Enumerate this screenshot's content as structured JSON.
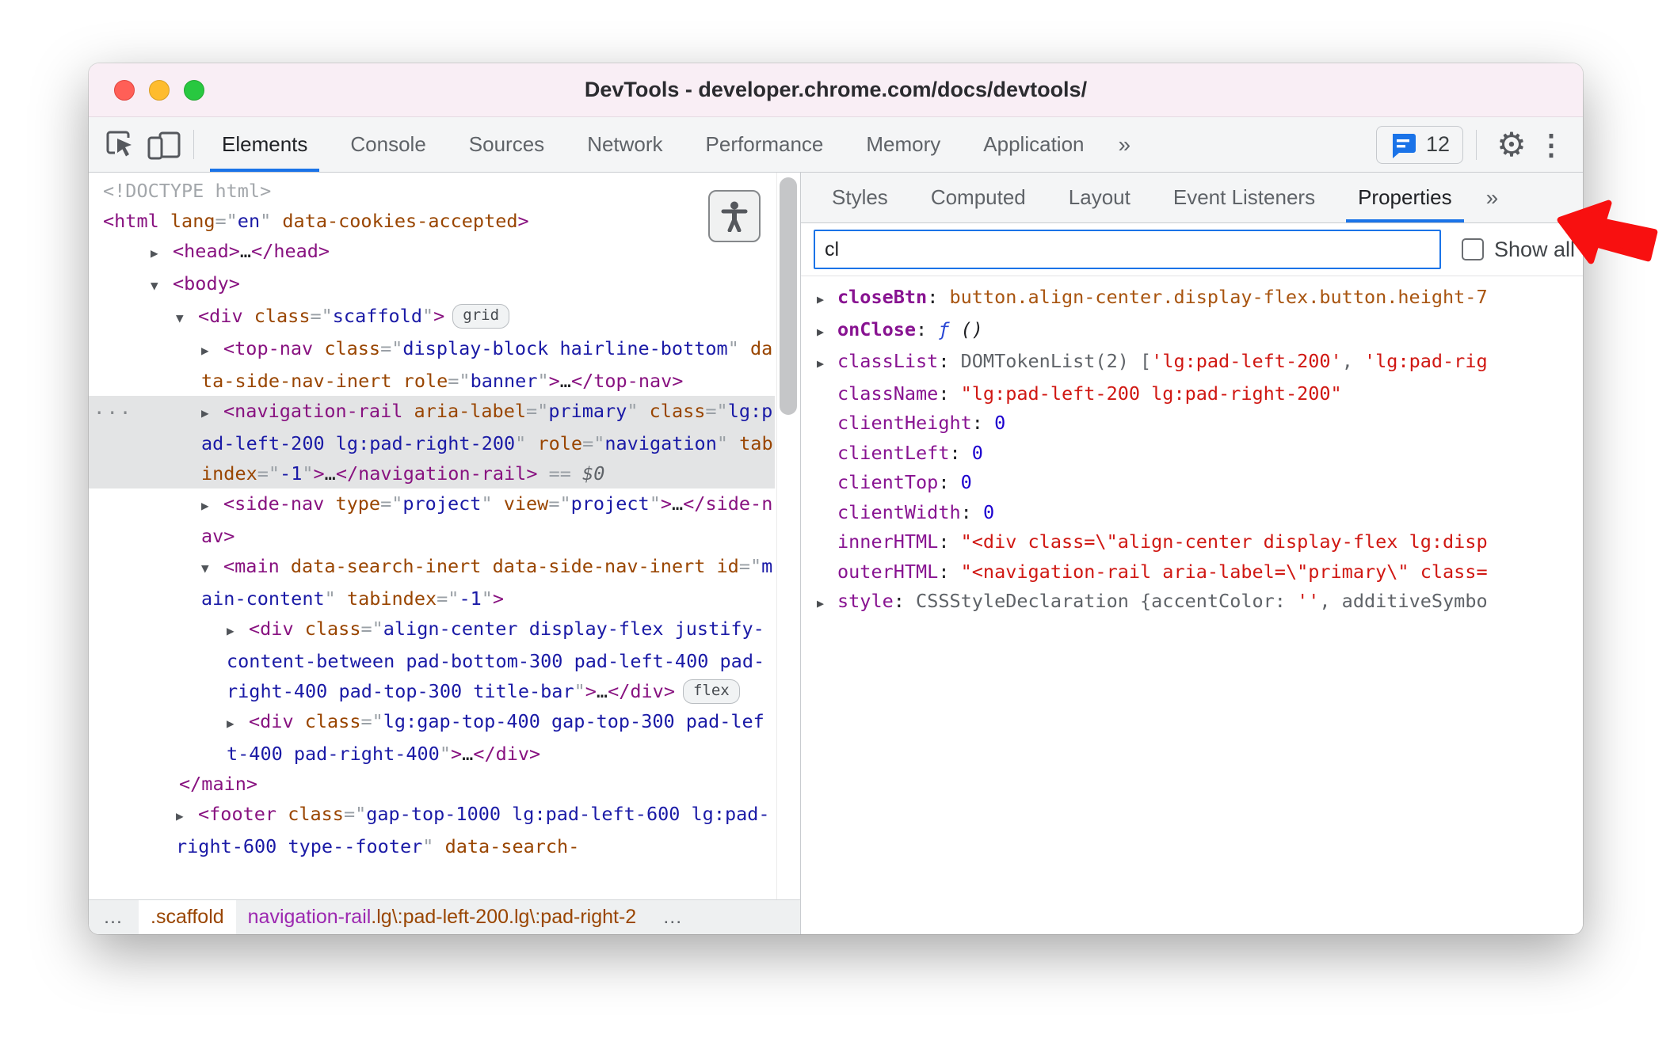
{
  "window": {
    "title": "DevTools - developer.chrome.com/docs/devtools/"
  },
  "colors": {
    "accent_blue": "#1a73e8",
    "titlebar_pink": "#f9eef5",
    "toolbar_gray": "#f4f5f6",
    "selection_gray": "#e3e4e5",
    "syntax_tag": "#881280",
    "syntax_attr_name": "#994500",
    "syntax_attr_value": "#1a1aa6",
    "prop_name_purple": "#881391",
    "string_red": "#d01712",
    "number_blue": "#1c00cf",
    "element_preview_brown": "#a8540f",
    "annotation_red": "#f81010",
    "crumb_tag_purple": "#9c27b0"
  },
  "toolbar": {
    "tabs": [
      {
        "label": "Elements",
        "active": true
      },
      {
        "label": "Console"
      },
      {
        "label": "Sources"
      },
      {
        "label": "Network"
      },
      {
        "label": "Performance"
      },
      {
        "label": "Memory"
      },
      {
        "label": "Application"
      }
    ],
    "more_tabs_chevron": "»",
    "issues": {
      "count": "12"
    }
  },
  "right_panel": {
    "tabs": [
      {
        "label": "Styles"
      },
      {
        "label": "Computed"
      },
      {
        "label": "Layout"
      },
      {
        "label": "Event Listeners"
      },
      {
        "label": "Properties",
        "active": true
      }
    ],
    "more_tabs_chevron": "»",
    "filter": {
      "value": "cl",
      "show_all_label": "Show all",
      "checked": false
    },
    "properties": [
      {
        "exp": true,
        "bold": true,
        "name": "closeBtn",
        "value": [
          {
            "t": "elem",
            "s": "button.align-center.display-flex.button.height-7"
          }
        ]
      },
      {
        "exp": true,
        "bold": true,
        "name": "onClose",
        "value": [
          {
            "t": "fn",
            "s": "ƒ"
          },
          {
            "t": "fnp",
            "s": " ()"
          }
        ]
      },
      {
        "exp": true,
        "name": "classList",
        "value": [
          {
            "t": "obj",
            "s": "DOMTokenList(2) ["
          },
          {
            "t": "str",
            "s": "'lg:pad-left-200'"
          },
          {
            "t": "obj",
            "s": ", "
          },
          {
            "t": "str",
            "s": "'lg:pad-rig"
          }
        ]
      },
      {
        "name": "className",
        "value": [
          {
            "t": "str",
            "s": "\"lg:pad-left-200 lg:pad-right-200\""
          }
        ]
      },
      {
        "name": "clientHeight",
        "value": [
          {
            "t": "num",
            "s": "0"
          }
        ]
      },
      {
        "name": "clientLeft",
        "value": [
          {
            "t": "num",
            "s": "0"
          }
        ]
      },
      {
        "name": "clientTop",
        "value": [
          {
            "t": "num",
            "s": "0"
          }
        ]
      },
      {
        "name": "clientWidth",
        "value": [
          {
            "t": "num",
            "s": "0"
          }
        ]
      },
      {
        "name": "innerHTML",
        "value": [
          {
            "t": "str",
            "s": "\"<div class=\\\"align-center display-flex lg:disp"
          }
        ]
      },
      {
        "name": "outerHTML",
        "value": [
          {
            "t": "str",
            "s": "\"<navigation-rail aria-label=\\\"primary\\\" class="
          }
        ]
      },
      {
        "exp": true,
        "name": "style",
        "value": [
          {
            "t": "obj",
            "s": "CSSStyleDeclaration {accentColor: "
          },
          {
            "t": "str",
            "s": "''"
          },
          {
            "t": "obj",
            "s": ", additiveSymbo"
          }
        ]
      }
    ]
  },
  "dom_tree": {
    "nodes": [
      {
        "indent": 0,
        "tokens": [
          {
            "t": "doctype",
            "s": "<!DOCTYPE html>"
          }
        ]
      },
      {
        "indent": 0,
        "tokens": [
          {
            "t": "tag",
            "s": "<html"
          },
          {
            "t": "attr",
            "s": " lang"
          },
          {
            "t": "q",
            "s": "=\""
          },
          {
            "t": "val",
            "s": "en"
          },
          {
            "t": "q",
            "s": "\""
          },
          {
            "t": "attr",
            "s": " data-cookies-accepted"
          },
          {
            "t": "tag",
            "s": ">"
          }
        ]
      },
      {
        "indent": 1,
        "arrow": "r",
        "tokens": [
          {
            "t": "tag",
            "s": "<head>"
          },
          {
            "t": "txt",
            "s": "…"
          },
          {
            "t": "tag",
            "s": "</head>"
          }
        ]
      },
      {
        "indent": 1,
        "arrow": "d",
        "tokens": [
          {
            "t": "tag",
            "s": "<body>"
          }
        ]
      },
      {
        "indent": 2,
        "arrow": "d",
        "tokens": [
          {
            "t": "tag",
            "s": "<div"
          },
          {
            "t": "attr",
            "s": " class"
          },
          {
            "t": "q",
            "s": "=\""
          },
          {
            "t": "val",
            "s": "scaffold"
          },
          {
            "t": "q",
            "s": "\""
          },
          {
            "t": "tag",
            "s": ">"
          },
          {
            "t": "badge",
            "s": "grid"
          }
        ]
      },
      {
        "indent": 3,
        "arrow": "r",
        "tokens": [
          {
            "t": "tag",
            "s": "<top-nav"
          },
          {
            "t": "attr",
            "s": " class"
          },
          {
            "t": "q",
            "s": "=\""
          },
          {
            "t": "val",
            "s": "display-block hairline-bottom"
          },
          {
            "t": "q",
            "s": "\""
          },
          {
            "t": "attr",
            "s": " data-side-nav-inert"
          },
          {
            "t": "attr",
            "s": " role"
          },
          {
            "t": "q",
            "s": "=\""
          },
          {
            "t": "val",
            "s": "banner"
          },
          {
            "t": "q",
            "s": "\""
          },
          {
            "t": "tag",
            "s": ">"
          },
          {
            "t": "txt",
            "s": "…"
          },
          {
            "t": "tag",
            "s": "</top-nav>"
          }
        ]
      },
      {
        "indent": 3,
        "arrow": "r",
        "selected": true,
        "gutter": true,
        "tokens": [
          {
            "t": "tag",
            "s": "<navigation-rail"
          },
          {
            "t": "attr",
            "s": " aria-label"
          },
          {
            "t": "q",
            "s": "=\""
          },
          {
            "t": "val",
            "s": "primary"
          },
          {
            "t": "q",
            "s": "\""
          },
          {
            "t": "attr",
            "s": " class"
          },
          {
            "t": "q",
            "s": "=\""
          },
          {
            "t": "val",
            "s": "lg:pad-left-200 lg:pad-right-200"
          },
          {
            "t": "q",
            "s": "\""
          },
          {
            "t": "attr",
            "s": " role"
          },
          {
            "t": "q",
            "s": "=\""
          },
          {
            "t": "val",
            "s": "navigation"
          },
          {
            "t": "q",
            "s": "\""
          },
          {
            "t": "attr",
            "s": " tabindex"
          },
          {
            "t": "q",
            "s": "=\""
          },
          {
            "t": "val",
            "s": "-1"
          },
          {
            "t": "q",
            "s": "\""
          },
          {
            "t": "tag",
            "s": ">"
          },
          {
            "t": "txt",
            "s": "…"
          },
          {
            "t": "tag",
            "s": "</navigation-rail>"
          },
          {
            "t": "eqd",
            "s": " == "
          },
          {
            "t": "dol",
            "s": "$0"
          }
        ]
      },
      {
        "indent": 3,
        "arrow": "r",
        "tokens": [
          {
            "t": "tag",
            "s": "<side-nav"
          },
          {
            "t": "attr",
            "s": " type"
          },
          {
            "t": "q",
            "s": "=\""
          },
          {
            "t": "val",
            "s": "project"
          },
          {
            "t": "q",
            "s": "\""
          },
          {
            "t": "attr",
            "s": " view"
          },
          {
            "t": "q",
            "s": "=\""
          },
          {
            "t": "val",
            "s": "project"
          },
          {
            "t": "q",
            "s": "\""
          },
          {
            "t": "tag",
            "s": ">"
          },
          {
            "t": "txt",
            "s": "…"
          },
          {
            "t": "tag",
            "s": "</side-nav>"
          }
        ]
      },
      {
        "indent": 3,
        "arrow": "d",
        "tokens": [
          {
            "t": "tag",
            "s": "<main"
          },
          {
            "t": "attr",
            "s": " data-search-inert"
          },
          {
            "t": "attr",
            "s": " data-side-nav-inert"
          },
          {
            "t": "attr",
            "s": " id"
          },
          {
            "t": "q",
            "s": "=\""
          },
          {
            "t": "val",
            "s": "main-content"
          },
          {
            "t": "q",
            "s": "\""
          },
          {
            "t": "attr",
            "s": " tabindex"
          },
          {
            "t": "q",
            "s": "=\""
          },
          {
            "t": "val",
            "s": "-1"
          },
          {
            "t": "q",
            "s": "\""
          },
          {
            "t": "tag",
            "s": ">"
          }
        ]
      },
      {
        "indent": 4,
        "arrow": "r",
        "tokens": [
          {
            "t": "tag",
            "s": "<div"
          },
          {
            "t": "attr",
            "s": " class"
          },
          {
            "t": "q",
            "s": "=\""
          },
          {
            "t": "val",
            "s": "align-center display-flex justify-content-between pad-bottom-300 pad-left-400 pad-right-400 pad-top-300 title-bar"
          },
          {
            "t": "q",
            "s": "\""
          },
          {
            "t": "tag",
            "s": ">"
          },
          {
            "t": "txt",
            "s": "…"
          },
          {
            "t": "tag",
            "s": "</div>"
          },
          {
            "t": "badge",
            "s": "flex"
          }
        ]
      },
      {
        "indent": 4,
        "arrow": "r",
        "tokens": [
          {
            "t": "tag",
            "s": "<div"
          },
          {
            "t": "attr",
            "s": " class"
          },
          {
            "t": "q",
            "s": "=\""
          },
          {
            "t": "val",
            "s": "lg:gap-top-400 gap-top-300 pad-left-400 pad-right-400"
          },
          {
            "t": "q",
            "s": "\""
          },
          {
            "t": "tag",
            "s": ">"
          },
          {
            "t": "txt",
            "s": "…"
          },
          {
            "t": "tag",
            "s": "</div>"
          }
        ]
      },
      {
        "indent": 3,
        "tokens": [
          {
            "t": "tag",
            "s": "</main>"
          }
        ]
      },
      {
        "indent": 2,
        "arrow": "r",
        "tokens": [
          {
            "t": "tag",
            "s": "<footer"
          },
          {
            "t": "attr",
            "s": " class"
          },
          {
            "t": "q",
            "s": "=\""
          },
          {
            "t": "val",
            "s": "gap-top-1000 lg:pad-left-600 lg:pad-right-600 type--footer"
          },
          {
            "t": "q",
            "s": "\""
          },
          {
            "t": "attr",
            "s": " data-search-"
          }
        ]
      }
    ]
  },
  "breadcrumbs": {
    "items": [
      {
        "type": "more",
        "label": "…"
      },
      {
        "type": "crumb",
        "chip": true,
        "tokens": [
          {
            "t": "attr",
            "s": ".scaffold"
          }
        ]
      },
      {
        "type": "crumb",
        "tokens": [
          {
            "t": "tag",
            "s": "navigation-rail"
          },
          {
            "t": "attr",
            "s": ".lg\\:pad-left-200.lg\\:pad-right-2"
          }
        ]
      },
      {
        "type": "more",
        "label": "…"
      }
    ]
  }
}
